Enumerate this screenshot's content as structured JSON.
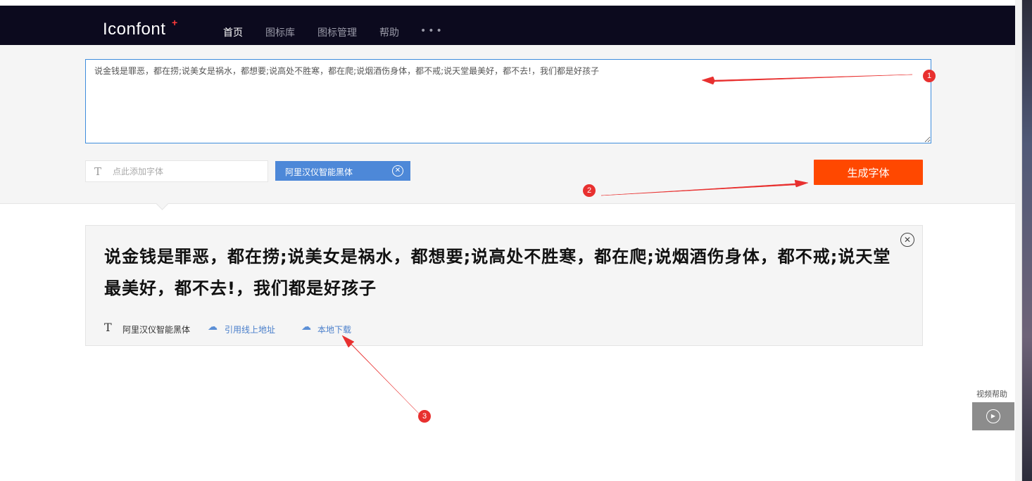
{
  "nav": {
    "logo": "Iconfont",
    "logo_plus": "+",
    "items": [
      "首页",
      "图标库",
      "图标管理",
      "帮助"
    ],
    "more": "•••"
  },
  "editor": {
    "text": "说金钱是罪恶，都在捞;说美女是祸水，都想要;说高处不胜寒，都在爬;说烟酒伤身体，都不戒;说天堂最美好，都不去!，我们都是好孩子"
  },
  "font_picker": {
    "icon": "text-format-icon",
    "placeholder": "点此添加字体",
    "selected_font": "阿里汉仪智能黑体",
    "close_glyph": "✕"
  },
  "generate_button": {
    "label": "生成字体"
  },
  "result": {
    "preview": "说金钱是罪恶，都在捞;说美女是祸水，都想要;说高处不胜寒，都在爬;说烟酒伤身体，都不戒;说天堂最美好，都不去!，我们都是好孩子",
    "font_name": "阿里汉仪智能黑体",
    "online_link": "引用线上地址",
    "download_link": "本地下载",
    "close_glyph": "✕"
  },
  "annotations": [
    "1",
    "2",
    "3"
  ],
  "video_help": {
    "label": "视频帮助",
    "play": "▶"
  },
  "colors": {
    "nav_bg": "#0c0a1e",
    "accent_blue": "#4d88d8",
    "generate_orange": "#ff4800",
    "annotation_red": "#e8302f"
  }
}
